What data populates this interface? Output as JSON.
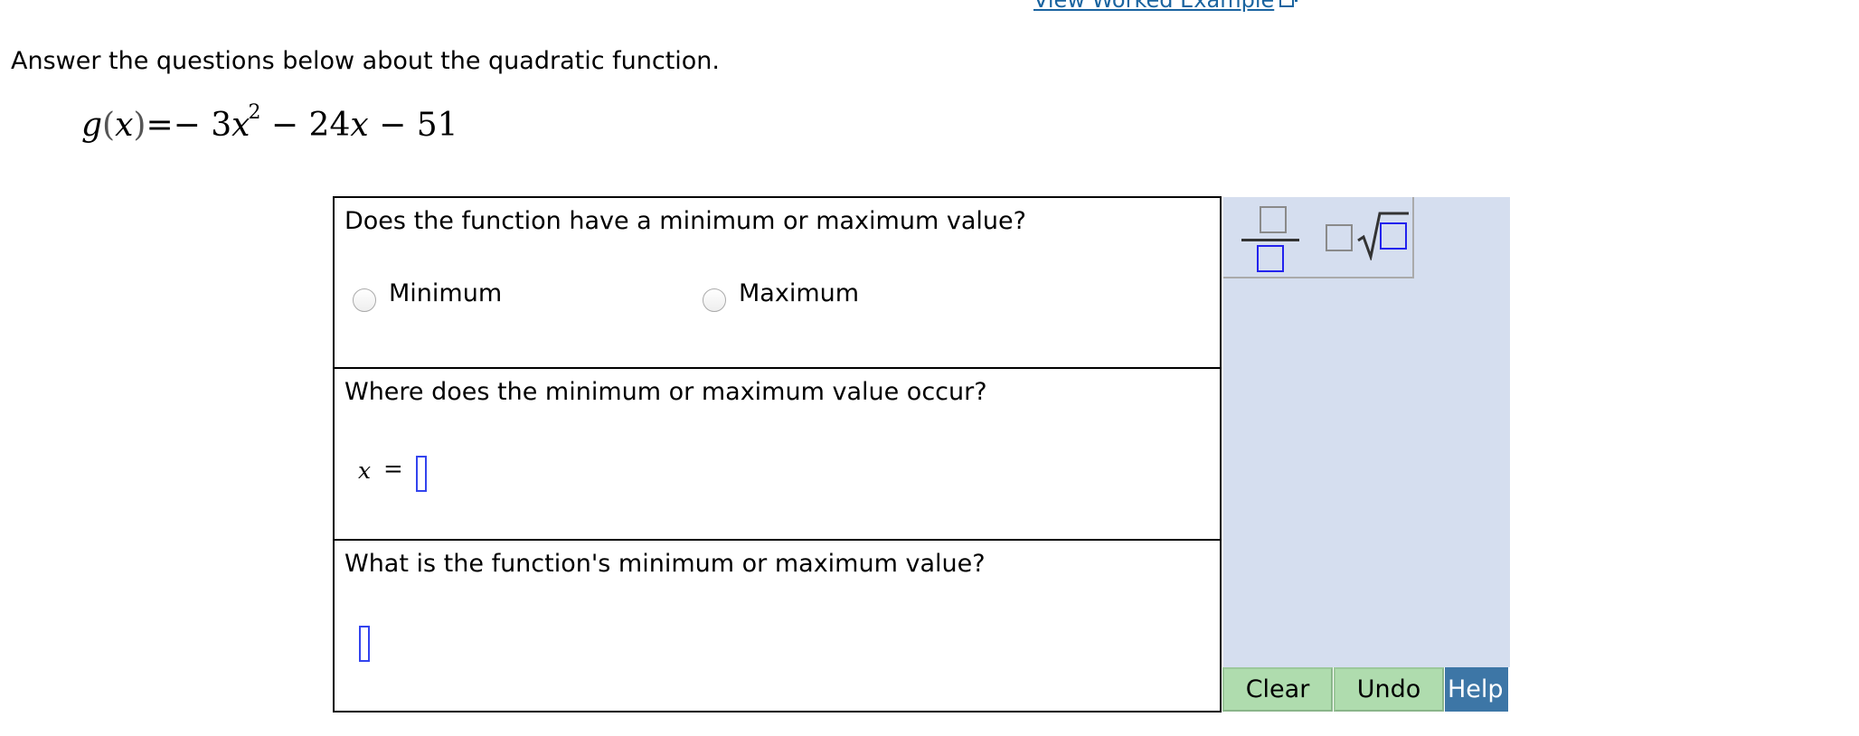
{
  "header": {
    "worked_example_link": "View Worked Example",
    "external_link_icon": "external-link-icon"
  },
  "instructions": "Answer the questions below about the quadratic function.",
  "function": {
    "name": "g",
    "variable": "x",
    "lhs_open": "(",
    "lhs_close": ")",
    "equals": "=",
    "term1_sign": "−",
    "term1_coef": "3",
    "term1_var": "x",
    "term1_exp": "2",
    "term2_sign": "−",
    "term2_coef": "24",
    "term2_var": "x",
    "term3_sign": "−",
    "term3_const": "51"
  },
  "questions": [
    {
      "text": "Does the function have a minimum or maximum value?",
      "options": [
        {
          "label": "Minimum",
          "selected": false
        },
        {
          "label": "Maximum",
          "selected": false
        }
      ]
    },
    {
      "text": "Where does the minimum or maximum value occur?",
      "answer_prefix_var": "x",
      "answer_prefix_eq": "=",
      "answer_value": ""
    },
    {
      "text": "What is the function's minimum or maximum value?",
      "answer_value": ""
    }
  ],
  "toolbar": {
    "tools": [
      {
        "name": "fraction",
        "icon": "fraction-icon"
      },
      {
        "name": "nth-root",
        "icon": "nth-root-icon"
      }
    ]
  },
  "buttons": {
    "clear": "Clear",
    "undo": "Undo",
    "help": "Help"
  },
  "colors": {
    "link": "#1a64a0",
    "toolbar_bg": "#d5deef",
    "action_green": "#afdcae",
    "help_blue": "#3d76a6",
    "answer_box": "#3344ee"
  }
}
